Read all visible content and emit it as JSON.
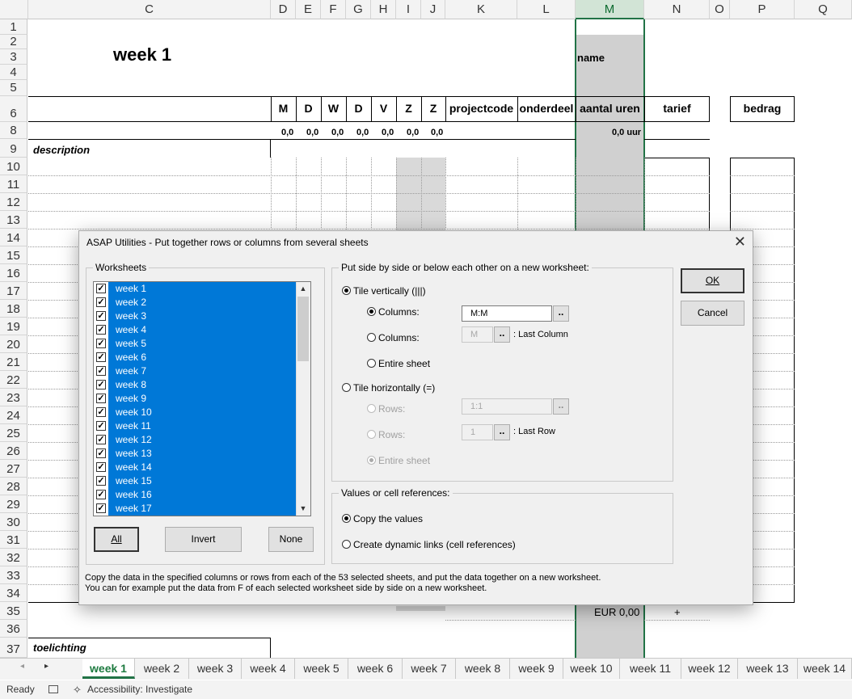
{
  "columns": [
    "C",
    "D",
    "E",
    "F",
    "G",
    "H",
    "I",
    "J",
    "K",
    "L",
    "M",
    "N",
    "O",
    "P",
    "Q"
  ],
  "rows": [
    "1",
    "2",
    "3",
    "4",
    "5",
    "6",
    "8",
    "9",
    "10",
    "11",
    "12",
    "13",
    "14",
    "15",
    "16",
    "17",
    "18",
    "19",
    "20",
    "21",
    "22",
    "23",
    "24",
    "25",
    "26",
    "27",
    "28",
    "29",
    "30",
    "31",
    "32",
    "33",
    "34",
    "35",
    "36",
    "37"
  ],
  "sheet": {
    "title": "week 1",
    "name_label": "name",
    "headers": {
      "days": [
        "M",
        "D",
        "W",
        "D",
        "V",
        "Z",
        "Z"
      ],
      "projectcode": "projectcode",
      "onderdeel": "onderdeel",
      "aantal_uren": "aantal uren",
      "tarief": "tarief",
      "bedrag": "bedrag"
    },
    "day_totals": [
      "0,0",
      "0,0",
      "0,0",
      "0,0",
      "0,0",
      "0,0",
      "0,0"
    ],
    "total_hours": "0,0 uur",
    "description_label": "description",
    "eur_total": "EUR 0,00",
    "plus": "+",
    "toelichting_label": "toelichting"
  },
  "tabs": [
    "week 1",
    "week 2",
    "week 3",
    "week 4",
    "week 5",
    "week 6",
    "week 7",
    "week 8",
    "week 9",
    "week 10",
    "week 11",
    "week 12",
    "week 13",
    "week 14"
  ],
  "status": {
    "ready": "Ready",
    "accessibility": "Accessibility: Investigate"
  },
  "dialog": {
    "title": "ASAP Utilities - Put together rows or columns from several sheets",
    "close": "✕",
    "worksheets_label": "Worksheets",
    "worksheet_items": [
      "week 1",
      "week 2",
      "week 3",
      "week 4",
      "week 5",
      "week 6",
      "week 7",
      "week 8",
      "week 9",
      "week 10",
      "week 11",
      "week 12",
      "week 13",
      "week 14",
      "week 15",
      "week 16",
      "week 17"
    ],
    "all_btn": "All",
    "invert_btn": "Invert",
    "none_btn": "None",
    "placement_label": "Put side by side or below each other on a new worksheet:",
    "tile_vertically": "Tile vertically (|||)",
    "columns1_label": "Columns:",
    "columns1_value": "M:M",
    "columns2_label": "Columns:",
    "columns2_value": "M",
    "last_column": ": Last Column",
    "entire_sheet1": "Entire sheet",
    "tile_horizontally": "Tile horizontally (=)",
    "rows1_label": "Rows:",
    "rows1_value": "1:1",
    "rows2_label": "Rows:",
    "rows2_value": "1",
    "last_row": ": Last Row",
    "entire_sheet2": "Entire sheet",
    "values_label": "Values or cell references:",
    "copy_values": "Copy the values",
    "dynamic_links": "Create dynamic links (cell references)",
    "ok_btn": "OK",
    "cancel_btn": "Cancel",
    "pick": "..",
    "desc1": "Copy the data in the specified columns or rows from each of the 53 selected sheets, and put the data together on a new worksheet.",
    "desc2": "You can for example put the data from F of each selected worksheet side by side on a new worksheet."
  },
  "colors": {
    "selection": "#0078d7",
    "excel_green": "#217346"
  }
}
